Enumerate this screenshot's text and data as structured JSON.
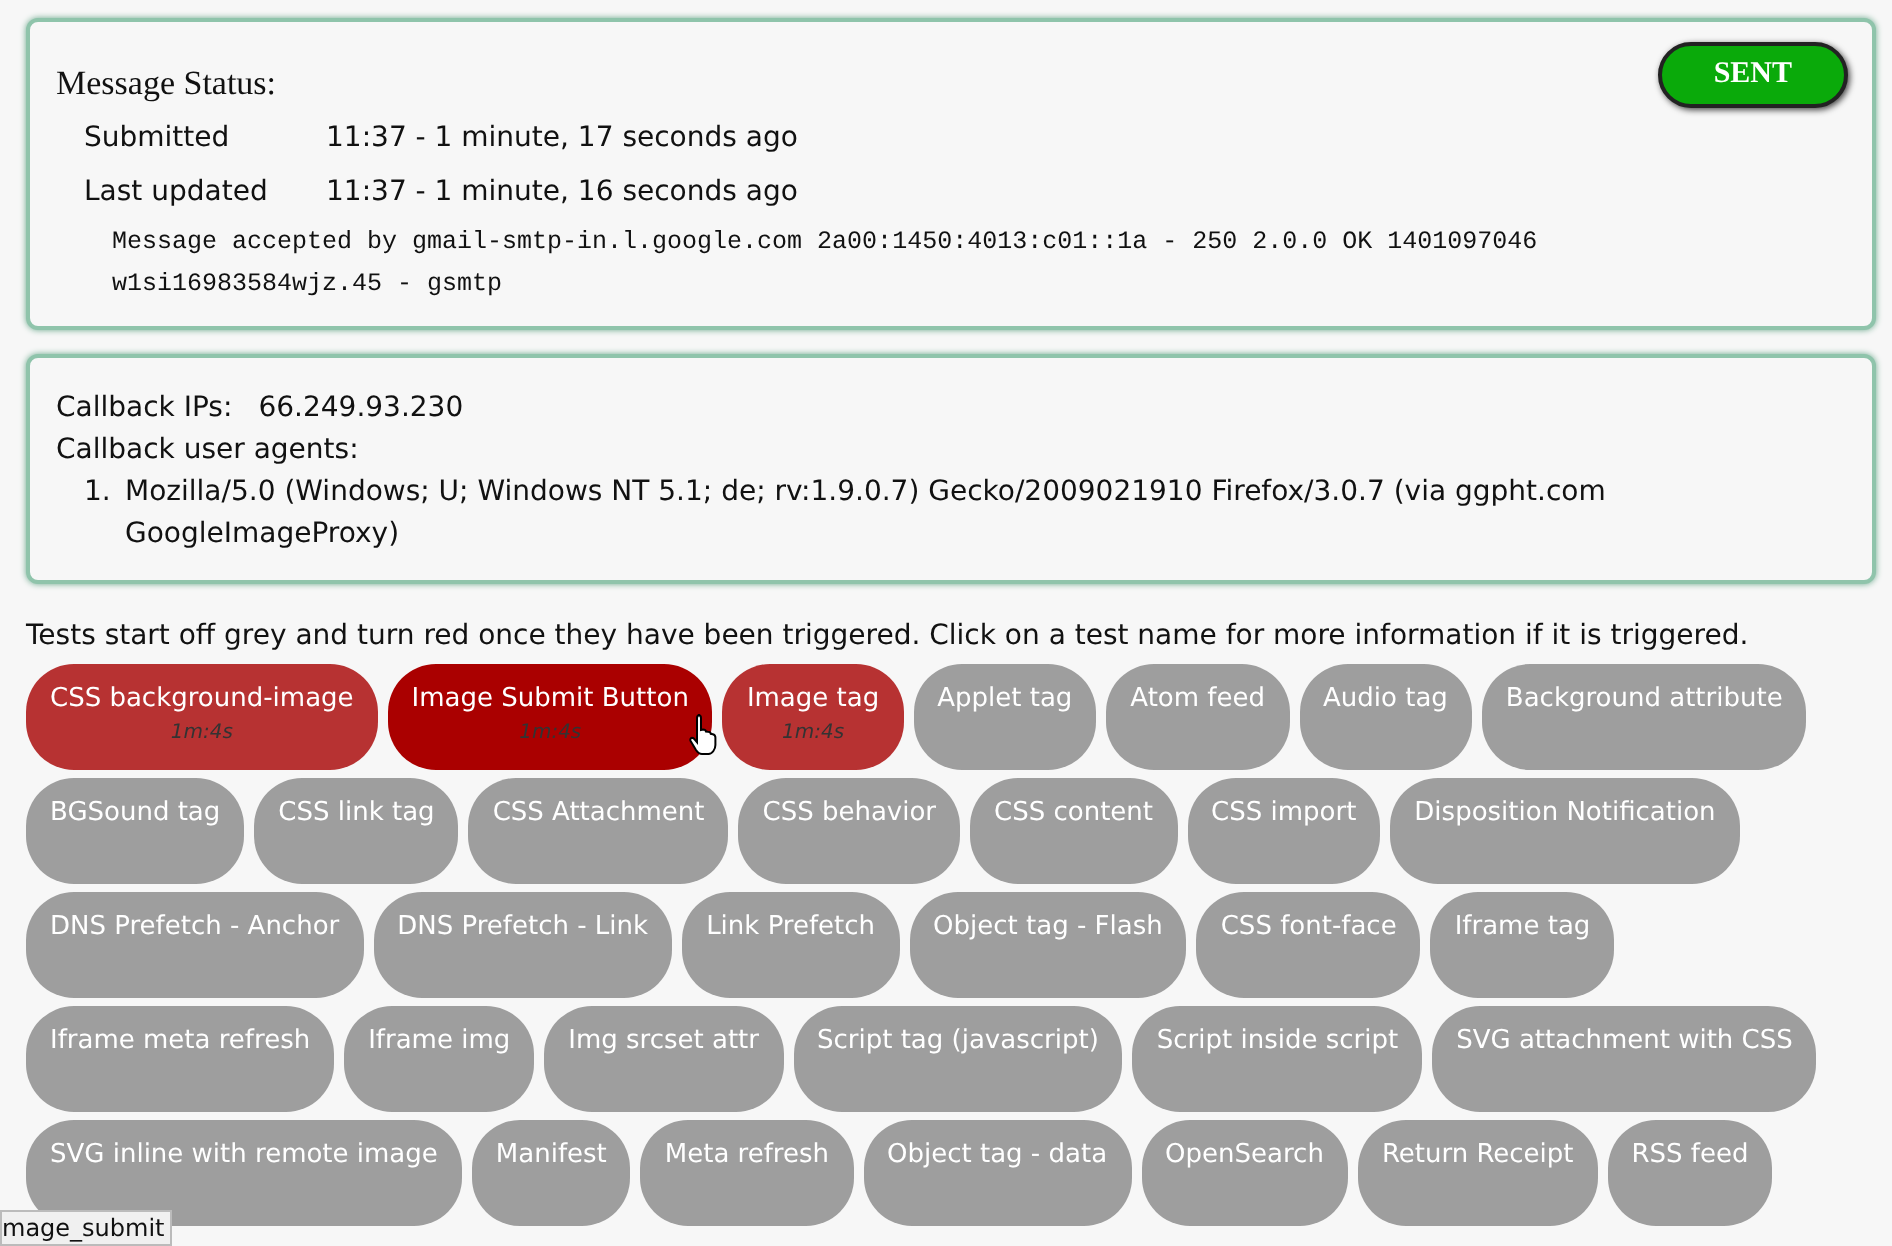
{
  "message_status": {
    "title": "Message Status:",
    "badge": "SENT",
    "fields": [
      {
        "label": "Submitted",
        "value": "11:37 - 1 minute, 17 seconds ago"
      },
      {
        "label": "Last updated",
        "value": "11:37 - 1 minute, 16 seconds ago"
      }
    ],
    "response": "Message accepted by gmail-smtp-in.l.google.com 2a00:1450:4013:c01::1a - 250 2.0.0 OK 1401097046 w1si16983584wjz.45 - gsmtp"
  },
  "callback": {
    "ips_label": "Callback IPs:",
    "ips_value": "66.249.93.230",
    "agents_label": "Callback user agents:",
    "agents": [
      {
        "number": "1.",
        "text": "Mozilla/5.0 (Windows; U; Windows NT 5.1; de; rv:1.9.0.7) Gecko/2009021910 Firefox/3.0.7 (via ggpht.com GoogleImageProxy)"
      }
    ]
  },
  "intro": "Tests start off grey and turn red once they have been triggered. Click on a test name for more information if it is triggered.",
  "tests": [
    {
      "name": "CSS background-image",
      "triggered": true,
      "hovered": false,
      "time": "1m:4s"
    },
    {
      "name": "Image Submit Button",
      "triggered": true,
      "hovered": true,
      "time": "1m:4s"
    },
    {
      "name": "Image tag",
      "triggered": true,
      "hovered": false,
      "time": "1m:4s"
    },
    {
      "name": "Applet tag",
      "triggered": false,
      "hovered": false
    },
    {
      "name": "Atom feed",
      "triggered": false,
      "hovered": false
    },
    {
      "name": "Audio tag",
      "triggered": false,
      "hovered": false
    },
    {
      "name": "Background attribute",
      "triggered": false,
      "hovered": false
    },
    {
      "name": "BGSound tag",
      "triggered": false,
      "hovered": false
    },
    {
      "name": "CSS link tag",
      "triggered": false,
      "hovered": false
    },
    {
      "name": "CSS Attachment",
      "triggered": false,
      "hovered": false
    },
    {
      "name": "CSS behavior",
      "triggered": false,
      "hovered": false
    },
    {
      "name": "CSS content",
      "triggered": false,
      "hovered": false
    },
    {
      "name": "CSS import",
      "triggered": false,
      "hovered": false
    },
    {
      "name": "Disposition Notification",
      "triggered": false,
      "hovered": false
    },
    {
      "name": "DNS Prefetch - Anchor",
      "triggered": false,
      "hovered": false
    },
    {
      "name": "DNS Prefetch - Link",
      "triggered": false,
      "hovered": false
    },
    {
      "name": "Link Prefetch",
      "triggered": false,
      "hovered": false
    },
    {
      "name": "Object tag - Flash",
      "triggered": false,
      "hovered": false
    },
    {
      "name": "CSS font-face",
      "triggered": false,
      "hovered": false
    },
    {
      "name": "Iframe tag",
      "triggered": false,
      "hovered": false
    },
    {
      "name": "Iframe meta refresh",
      "triggered": false,
      "hovered": false
    },
    {
      "name": "Iframe img",
      "triggered": false,
      "hovered": false
    },
    {
      "name": "Img srcset attr",
      "triggered": false,
      "hovered": false
    },
    {
      "name": "Script tag (javascript)",
      "triggered": false,
      "hovered": false
    },
    {
      "name": "Script inside script",
      "triggered": false,
      "hovered": false
    },
    {
      "name": "SVG attachment with CSS",
      "triggered": false,
      "hovered": false
    },
    {
      "name": "SVG inline with remote image",
      "triggered": false,
      "hovered": false
    },
    {
      "name": "Manifest",
      "triggered": false,
      "hovered": false
    },
    {
      "name": "Meta refresh",
      "triggered": false,
      "hovered": false
    },
    {
      "name": "Object tag - data",
      "triggered": false,
      "hovered": false
    },
    {
      "name": "OpenSearch",
      "triggered": false,
      "hovered": false
    },
    {
      "name": "Return Receipt",
      "triggered": false,
      "hovered": false
    },
    {
      "name": "RSS feed",
      "triggered": false,
      "hovered": false
    }
  ],
  "status_bar": "mage_submit"
}
